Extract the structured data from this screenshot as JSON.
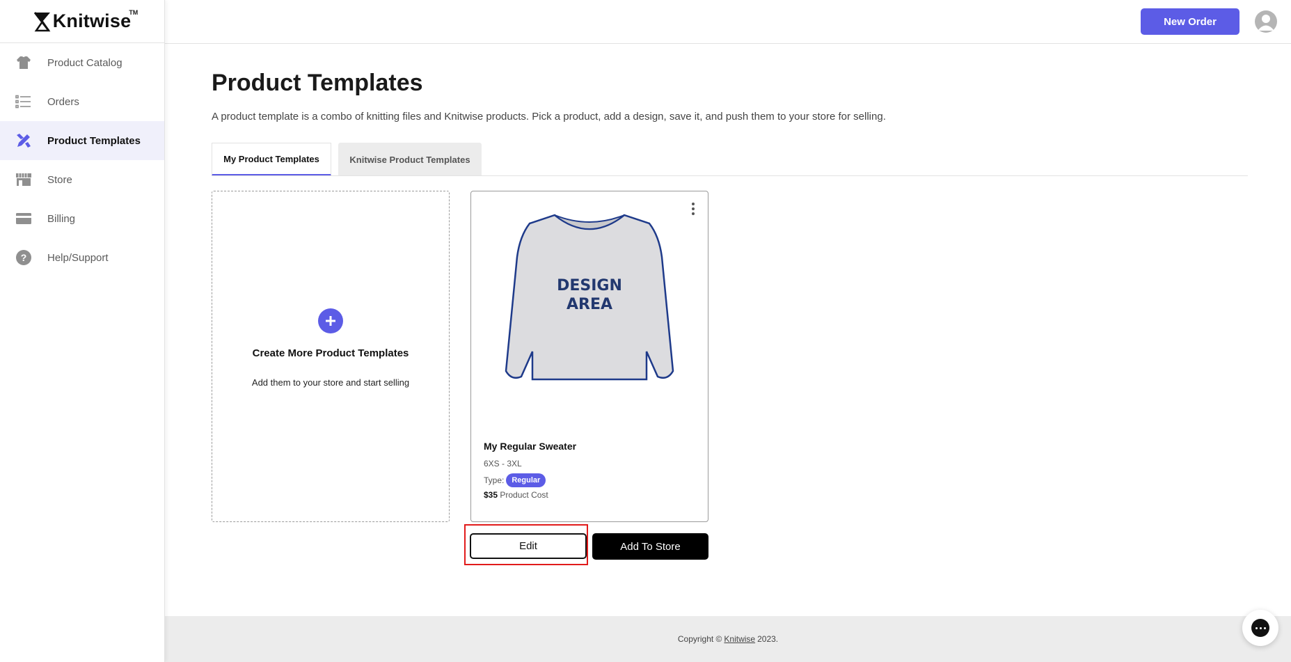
{
  "brand": {
    "name": "Knitwise",
    "tm": "TM"
  },
  "sidebar": {
    "items": [
      {
        "label": "Product Catalog",
        "icon": "sweater-icon",
        "active": false
      },
      {
        "label": "Orders",
        "icon": "list-icon",
        "active": false
      },
      {
        "label": "Product Templates",
        "icon": "design-tools-icon",
        "active": true
      },
      {
        "label": "Store",
        "icon": "storefront-icon",
        "active": false
      },
      {
        "label": "Billing",
        "icon": "credit-card-icon",
        "active": false
      },
      {
        "label": "Help/Support",
        "icon": "help-icon",
        "active": false
      }
    ]
  },
  "header": {
    "new_order_label": "New Order",
    "avatar_icon": "user-icon"
  },
  "page": {
    "title": "Product Templates",
    "description": "A product template is a combo of knitting files and Knitwise products. Pick a product, add a design, save it, and push them to your store for selling.",
    "tabs": [
      {
        "label": "My Product Templates",
        "active": true
      },
      {
        "label": "Knitwise Product Templates",
        "active": false
      }
    ]
  },
  "create_card": {
    "title": "Create More Product Templates",
    "subtitle": "Add them to your store and start selling"
  },
  "product": {
    "image_text_line1": "DESIGN",
    "image_text_line2": "AREA",
    "name": "My Regular Sweater",
    "sizes": "6XS - 3XL",
    "type_label": "Type:",
    "type_value": "Regular",
    "price": "$35",
    "price_suffix": "Product Cost",
    "edit_label": "Edit",
    "add_to_store_label": "Add To Store"
  },
  "footer": {
    "prefix": "Copyright ©",
    "link": "Knitwise",
    "year": "2023."
  },
  "colors": {
    "accent": "#5c5ce6",
    "highlight": "#e11b1b",
    "sweater_outline": "#1e3a8a"
  }
}
